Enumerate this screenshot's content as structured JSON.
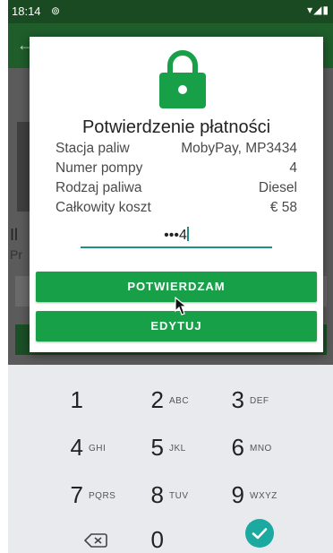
{
  "status_bar": {
    "time": "18:14",
    "sync_icon": "⊚",
    "right_icons": "▾◢▮"
  },
  "app_bar": {
    "back_icon": "←"
  },
  "background": {
    "title": "Il",
    "subtitle": "Pr"
  },
  "dialog": {
    "title": "Potwierdzenie płatności",
    "rows": [
      {
        "label": "Stacja paliw",
        "value": "MobyPay, MP3434"
      },
      {
        "label": "Numer pompy",
        "value": "4"
      },
      {
        "label": "Rodzaj paliwa",
        "value": "Diesel"
      },
      {
        "label": "Całkowity koszt",
        "value": "€ 58"
      }
    ],
    "pin_value": "•••4",
    "confirm_button": "POTWIERDZAM",
    "edit_button": "EDYTUJ"
  },
  "keypad": {
    "keys": [
      {
        "digit": "1",
        "letters": ""
      },
      {
        "digit": "2",
        "letters": "ABC"
      },
      {
        "digit": "3",
        "letters": "DEF"
      },
      {
        "digit": "4",
        "letters": "GHI"
      },
      {
        "digit": "5",
        "letters": "JKL"
      },
      {
        "digit": "6",
        "letters": "MNO"
      },
      {
        "digit": "7",
        "letters": "PQRS"
      },
      {
        "digit": "8",
        "letters": "TUV"
      },
      {
        "digit": "9",
        "letters": "WXYZ"
      },
      {
        "digit": "0",
        "letters": ""
      }
    ]
  },
  "colors": {
    "accent": "#18a049",
    "status_bar": "#1a4a22",
    "done_key": "#1ba9a0",
    "pin_underline": "#1f8f8a"
  }
}
